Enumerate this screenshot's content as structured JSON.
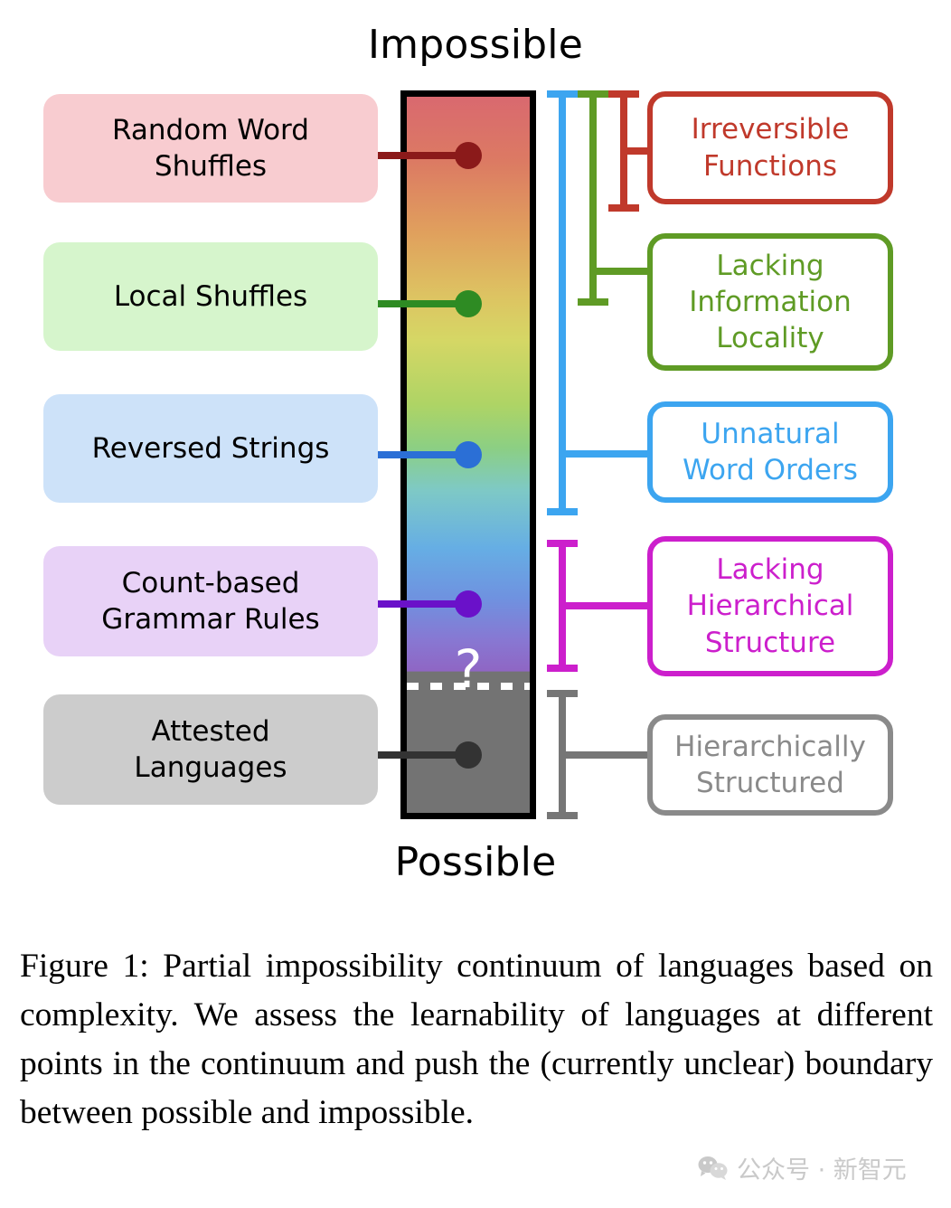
{
  "figure": {
    "poles": {
      "top": "Impossible",
      "bottom": "Possible"
    },
    "boundary_marker": "?",
    "continuum": {
      "gradient_stops": [
        "#d9696f",
        "#e0a05d",
        "#d5d765",
        "#8ccf83",
        "#7ec9c6",
        "#66aee4",
        "#8877d2"
      ],
      "possible_region_color": "#737373",
      "border_color": "#000000",
      "boundary_line_color": "#ffffff"
    },
    "left_items": [
      {
        "label": "Random Word\nShuffles",
        "fill": "#f8ccd0",
        "marker_color": "#8b1a1a"
      },
      {
        "label": "Local Shuffles",
        "fill": "#d6f5cc",
        "marker_color": "#2e8b23"
      },
      {
        "label": "Reversed Strings",
        "fill": "#cde2f9",
        "marker_color": "#2b6fd6"
      },
      {
        "label": "Count-based\nGrammar Rules",
        "fill": "#e8d2f7",
        "marker_color": "#6a11c9"
      },
      {
        "label": "Attested\nLanguages",
        "fill": "#cccccc",
        "marker_color": "#333333"
      }
    ],
    "right_categories": [
      {
        "label": "Irreversible\nFunctions",
        "color": "#c0392b"
      },
      {
        "label": "Lacking\nInformation\nLocality",
        "color": "#5f9b25"
      },
      {
        "label": "Unnatural\nWord Orders",
        "color": "#3ca5f0"
      },
      {
        "label": "Lacking\nHierarchical\nStructure",
        "color": "#cc1fcc"
      },
      {
        "label": "Hierarchically\nStructured",
        "color": "#767676"
      }
    ]
  },
  "caption": "Figure 1: Partial impossibility continuum of languages based on complexity. We assess the learnability of languages at different points in the continuum and push the (currently unclear) boundary between possible and impossible.",
  "watermark": {
    "text": "公众号 · 新智元"
  }
}
